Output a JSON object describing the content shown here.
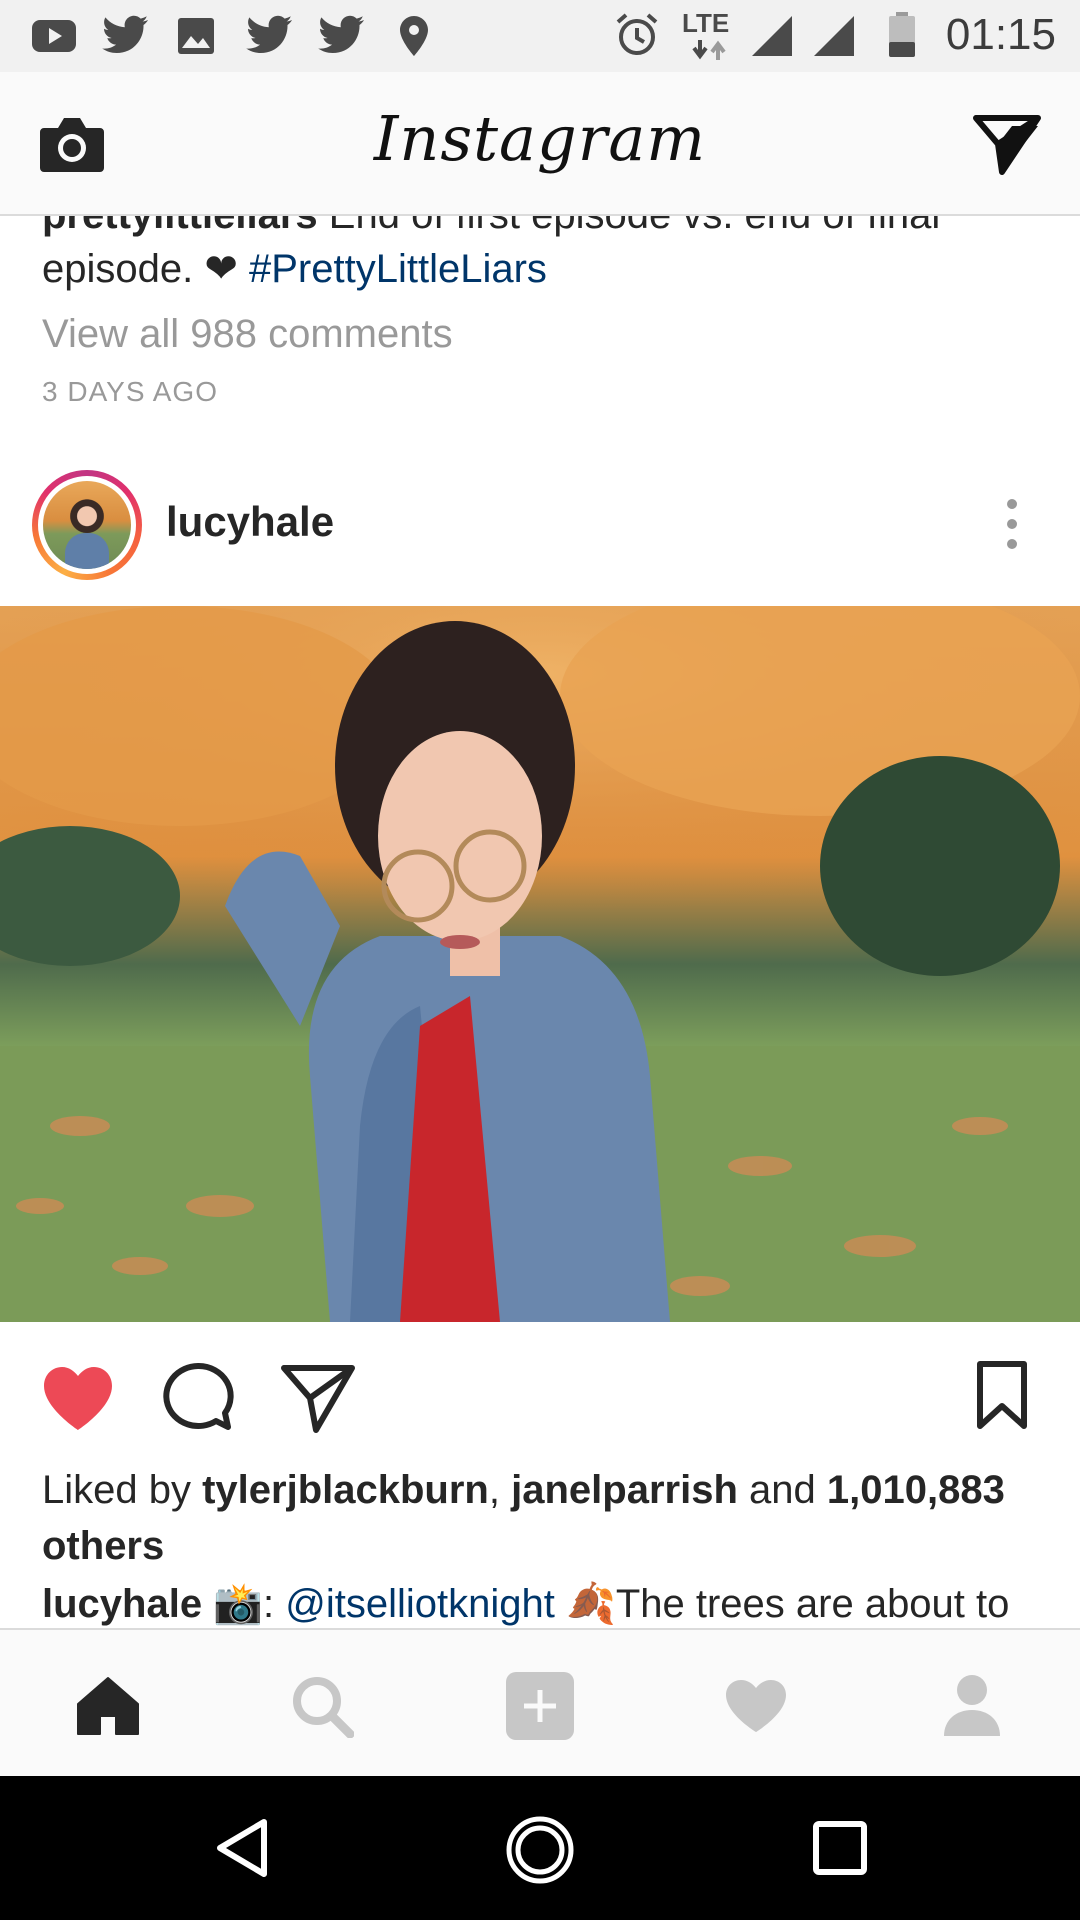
{
  "status_bar": {
    "time": "01:15",
    "network": "LTE",
    "left_icons": [
      "youtube-icon",
      "twitter-icon",
      "image-icon",
      "twitter-icon",
      "twitter-icon",
      "location-icon"
    ],
    "right_icons": [
      "alarm-icon",
      "lte-icon",
      "signal-icon",
      "signal-icon",
      "battery-icon"
    ]
  },
  "header": {
    "logo": "Instagram",
    "left_icon": "camera-icon",
    "right_icon": "direct-message-icon"
  },
  "previous_post": {
    "username": "prettylittleliars",
    "caption": "End of first episode vs. end of final episode.",
    "heart": "❤",
    "hashtag": "#PrettyLittleLiars",
    "view_comments": "View all 988 comments",
    "time_ago": "3 DAYS AGO"
  },
  "post": {
    "username": "lucyhale",
    "more_icon": "more-vertical-icon",
    "liked": true,
    "likes_prefix": "Liked by",
    "liker_1": "tylerjblackburn",
    "liker_separator": ",",
    "liker_2": "janelparrish",
    "likes_and": "and",
    "likes_count": "1,010,883",
    "likes_suffix": "others",
    "caption_username": "lucyhale",
    "caption_camera_emoji": "📸",
    "caption_colon": ":",
    "caption_mention": "@itselliotknight",
    "caption_leaf_emoji": "🍂",
    "caption_text": "The trees are about to",
    "colors": {
      "like_red": "#ed4956",
      "link_blue": "#003569",
      "muted_gray": "#999999"
    }
  },
  "bottom_nav": {
    "items": [
      "home-icon",
      "search-icon",
      "add-post-icon",
      "activity-heart-icon",
      "profile-icon"
    ],
    "active": "home-icon"
  },
  "system_nav": {
    "items": [
      "back-icon",
      "home-circle-icon",
      "recents-icon"
    ]
  }
}
